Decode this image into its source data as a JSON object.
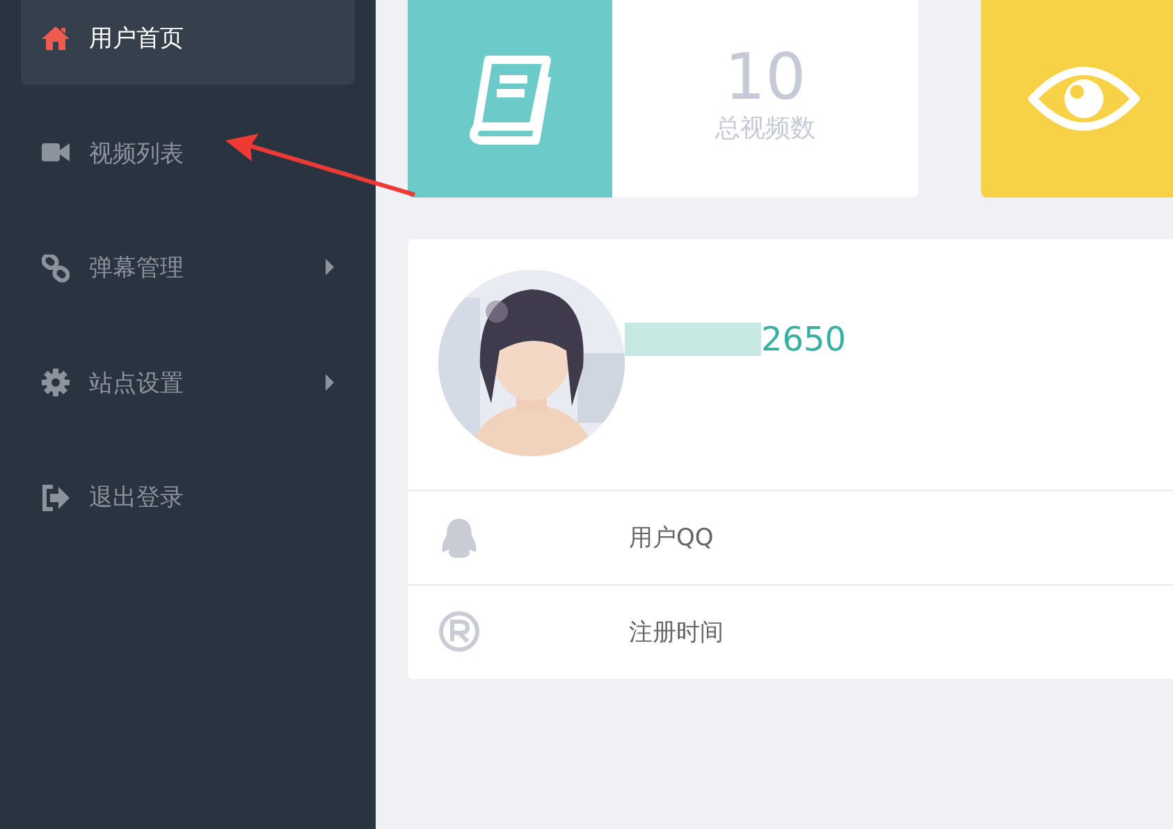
{
  "sidebar": {
    "items": [
      {
        "label": "用户首页",
        "kind": "home",
        "selected": true,
        "has_submenu": false
      },
      {
        "label": "视频列表",
        "kind": "video",
        "selected": false,
        "has_submenu": false
      },
      {
        "label": "弹幕管理",
        "kind": "link",
        "selected": false,
        "has_submenu": true
      },
      {
        "label": "站点设置",
        "kind": "gear",
        "selected": false,
        "has_submenu": true
      },
      {
        "label": "退出登录",
        "kind": "signout",
        "selected": false,
        "has_submenu": false
      }
    ]
  },
  "stat_cards": [
    {
      "kind": "book",
      "color": "#6ccbc8",
      "value": "10",
      "label": "总视频数"
    },
    {
      "kind": "eye",
      "color": "#f7d247"
    }
  ],
  "profile": {
    "username": "2650",
    "username_redacted": true,
    "info_rows": [
      {
        "kind": "qq",
        "label": "用户QQ"
      },
      {
        "kind": "registered",
        "label": "注册时间"
      }
    ]
  },
  "annotation": {
    "kind": "arrow",
    "color": "#ee3a35"
  }
}
